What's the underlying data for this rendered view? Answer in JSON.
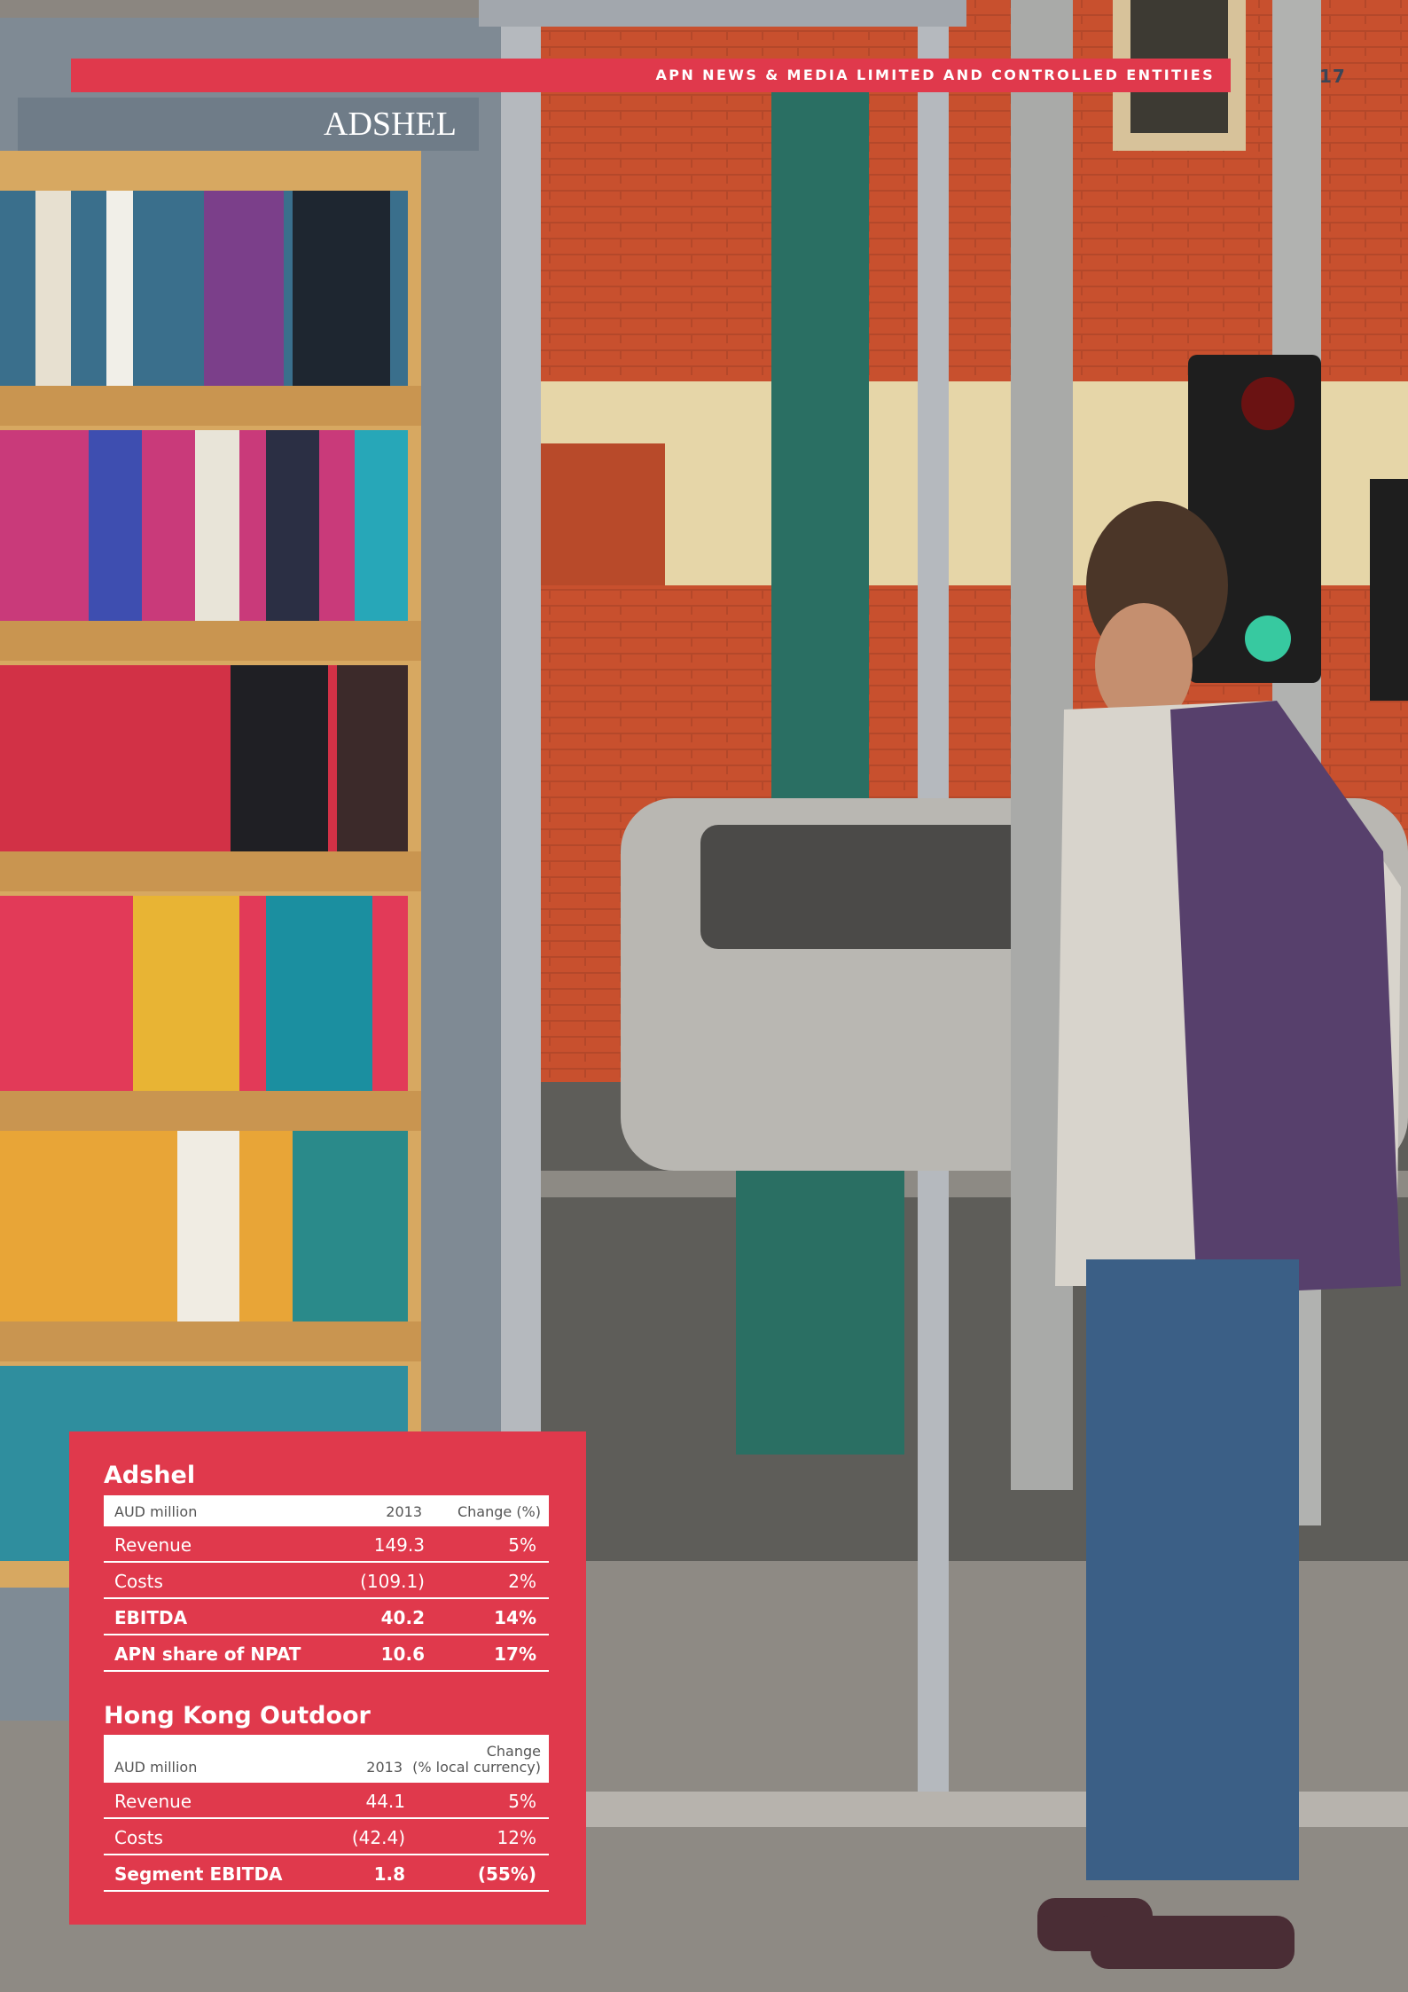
{
  "header": {
    "title": "APN NEWS & MEDIA LIMITED AND CONTROLLED ENTITIES",
    "page_number": "17"
  },
  "photo": {
    "shelter_sign": "ADSHEL"
  },
  "adshel": {
    "title": "Adshel",
    "columns": [
      "AUD million",
      "2013",
      "Change (%)"
    ],
    "rows": [
      {
        "label": "Revenue",
        "value": "149.3",
        "change": "5%"
      },
      {
        "label": "Costs",
        "value": "(109.1)",
        "change": "2%"
      },
      {
        "label": "EBITDA",
        "value": "40.2",
        "change": "14%"
      },
      {
        "label": "APN share of NPAT",
        "value": "10.6",
        "change": "17%"
      }
    ]
  },
  "hk_outdoor": {
    "title": "Hong Kong Outdoor",
    "columns": [
      "AUD million",
      "2013",
      "Change",
      "(% local currency)"
    ],
    "rows": [
      {
        "label": "Revenue",
        "value": "44.1",
        "change": "5%"
      },
      {
        "label": "Costs",
        "value": "(42.4)",
        "change": "12%"
      },
      {
        "label": "Segment EBITDA",
        "value": "1.8",
        "change": "(55%)"
      }
    ]
  },
  "colors": {
    "brand_red": "#e0394c",
    "page_number": "#3b4556"
  }
}
